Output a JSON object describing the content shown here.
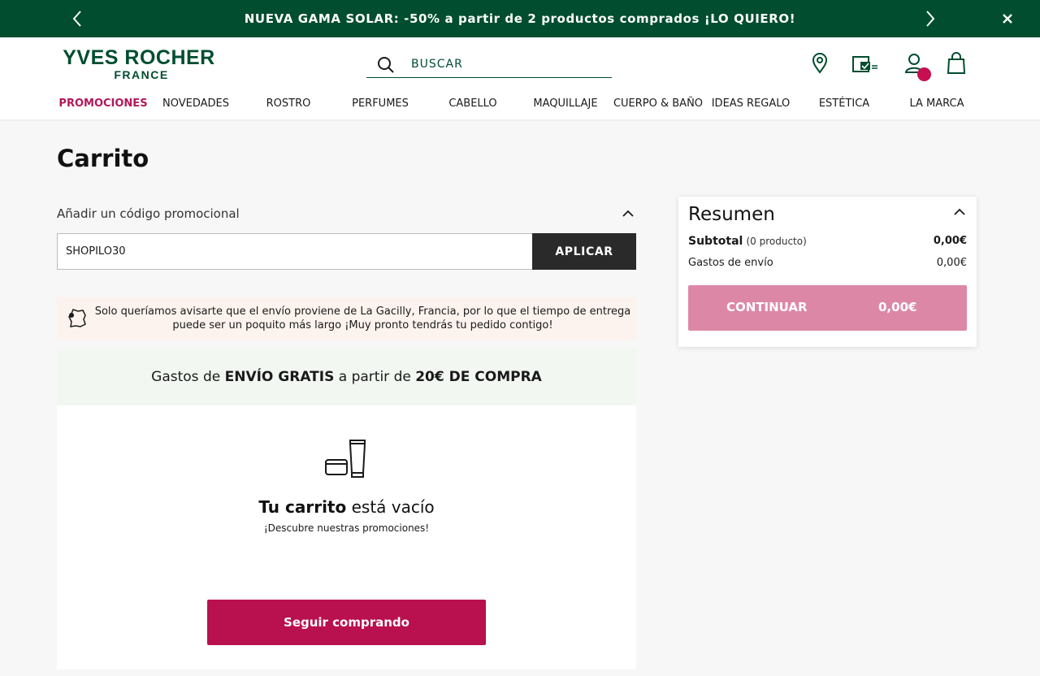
{
  "banner": {
    "text": "NUEVA GAMA SOLAR: -50% a partir de 2 productos comprados ¡LO QUIERO!",
    "icons": [
      "chevron-left-icon",
      "chevron-right-icon",
      "close-icon"
    ],
    "background": "#004d2f"
  },
  "header": {
    "logo_line1": "YVES ROCHER",
    "logo_line2": "FRANCE",
    "search_placeholder": "BUSCAR",
    "icons": [
      "location-pin-icon",
      "wallet-icon",
      "user-icon",
      "shopping-bag-icon"
    ],
    "nav": [
      "PROMOCIONES",
      "NOVEDADES",
      "ROSTRO",
      "PERFUMES",
      "CABELLO",
      "MAQUILLAJE",
      "CUERPO & BAÑO",
      "IDEAS REGALO",
      "ESTÉTICA",
      "LA MARCA"
    ],
    "active_nav": "PROMOCIONES"
  },
  "page": {
    "title": "Carrito"
  },
  "promo_code": {
    "label": "Añadir un código promocional",
    "value": "SHOPILO30",
    "button": "APLICAR"
  },
  "notice": {
    "text": "Solo queríamos avisarte que el envío proviene de La Gacilly, Francia, por lo que el tiempo de entrega puede ser un poquito más largo ¡Muy pronto tendrás tu pedido contigo!"
  },
  "free_shipping": {
    "part1": "Gastos de ",
    "part2": "ENVÍO GRATIS",
    "part3": " a partir de ",
    "part4": "20€ DE COMPRA"
  },
  "empty_cart": {
    "headline_bold": "Tu carrito",
    "headline_rest": " está vacío",
    "sub": "¡Descubre nuestras promociones!",
    "button": "Seguir comprando"
  },
  "summary": {
    "title": "Resumen",
    "subtotal_label": "Subtotal",
    "subtotal_count": "(0 producto)",
    "subtotal_value": "0,00€",
    "shipping_label": "Gastos de envío",
    "shipping_value": "0,00€",
    "continue_label": "CONTINUAR",
    "continue_value": "0,00€"
  },
  "colors": {
    "brand_green": "#004d2f",
    "accent_pink": "#b9104f",
    "continue_pink": "#dd87a7",
    "notice_bg": "#fdf3ee",
    "free_ship_bg": "#f2f7f2"
  }
}
